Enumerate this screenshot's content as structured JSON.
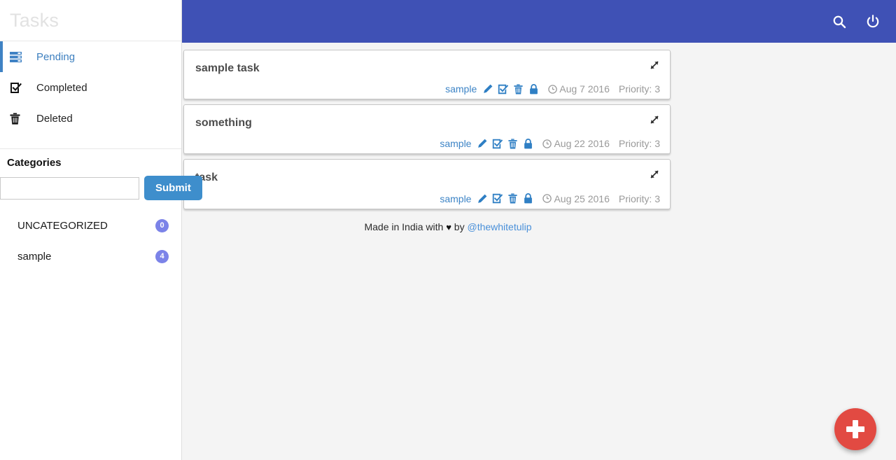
{
  "app": {
    "brand_title": "Tasks",
    "accent_header": "#3f51b5",
    "accent_link": "#3d84c6",
    "accent_submit": "#3e8ecc",
    "accent_fab": "#e24a42",
    "badge_color": "#7b83e8"
  },
  "appbar": {
    "search_icon": "search-icon",
    "power_icon": "power-icon"
  },
  "sidebar": {
    "nav": [
      {
        "label": "Pending",
        "icon": "list-icon",
        "active": true
      },
      {
        "label": "Completed",
        "icon": "check-square-icon",
        "active": false
      },
      {
        "label": "Deleted",
        "icon": "trash-icon",
        "active": false
      }
    ],
    "categories": {
      "title": "Categories",
      "input_value": "",
      "input_placeholder": "",
      "submit_label": "Submit",
      "items": [
        {
          "name": "UNCATEGORIZED",
          "count": "0"
        },
        {
          "name": "sample",
          "count": "4"
        }
      ]
    }
  },
  "main": {
    "tasks": [
      {
        "title": "sample task",
        "category": "sample",
        "date": "Aug 7 2016",
        "priority": "Priority: 3",
        "actions": [
          "edit-icon",
          "complete-icon",
          "delete-icon",
          "lock-icon"
        ],
        "expand_icon": "expand-icon"
      },
      {
        "title": "something",
        "category": "sample",
        "date": "Aug 22 2016",
        "priority": "Priority: 3",
        "actions": [
          "edit-icon",
          "complete-icon",
          "delete-icon",
          "lock-icon"
        ],
        "expand_icon": "expand-icon"
      },
      {
        "title": "task",
        "category": "sample",
        "date": "Aug 25 2016",
        "priority": "Priority: 3",
        "actions": [
          "edit-icon",
          "complete-icon",
          "delete-icon",
          "lock-icon"
        ],
        "expand_icon": "expand-icon"
      }
    ],
    "footer": {
      "prefix": "Made in India with",
      "heart": "♥",
      "middle": "by",
      "handle": "@thewhitetulip"
    },
    "fab_label": "+"
  }
}
